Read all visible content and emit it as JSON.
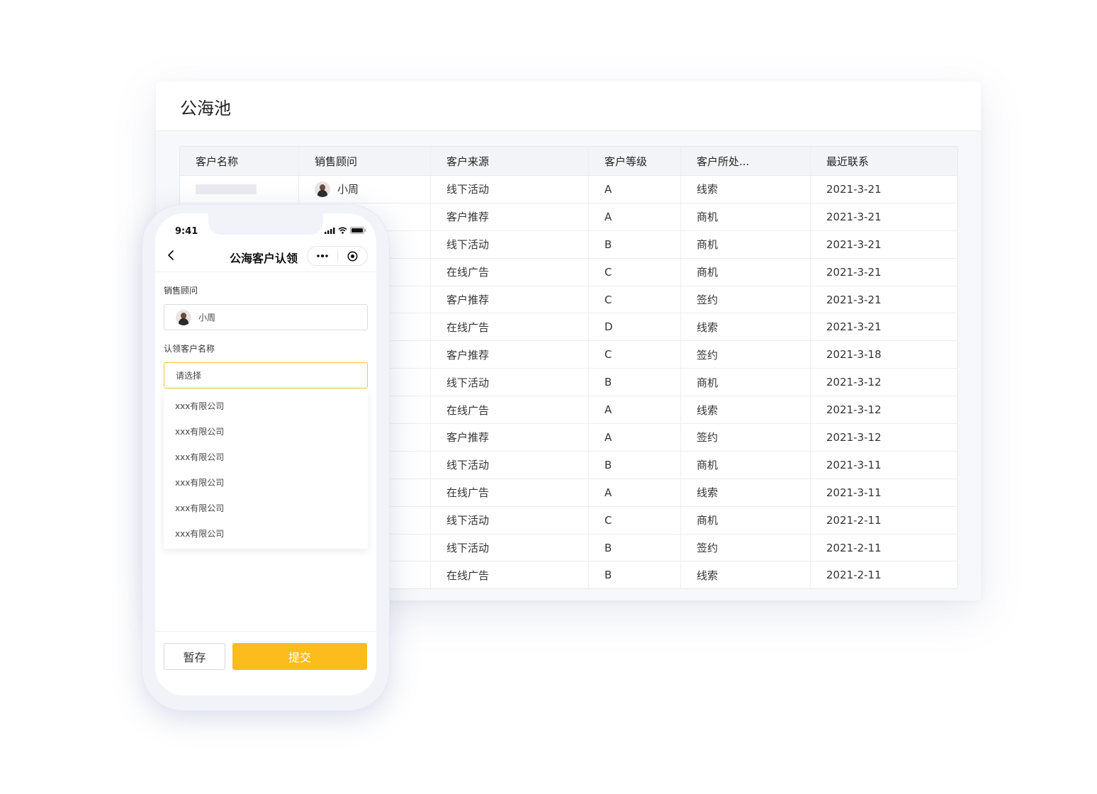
{
  "desktop": {
    "title": "公海池",
    "columns": [
      "客户名称",
      "销售顾问",
      "客户来源",
      "客户等级",
      "客户所处...",
      "最近联系"
    ],
    "first_row_advisor": "小周",
    "rows": [
      {
        "source": "线下活动",
        "level": "A",
        "stage": "线索",
        "date": "2021-3-21"
      },
      {
        "source": "客户推荐",
        "level": "A",
        "stage": "商机",
        "date": "2021-3-21"
      },
      {
        "source": "线下活动",
        "level": "B",
        "stage": "商机",
        "date": "2021-3-21"
      },
      {
        "source": "在线广告",
        "level": "C",
        "stage": "商机",
        "date": "2021-3-21"
      },
      {
        "source": "客户推荐",
        "level": "C",
        "stage": "签约",
        "date": "2021-3-21"
      },
      {
        "source": "在线广告",
        "level": "D",
        "stage": "线索",
        "date": "2021-3-21"
      },
      {
        "source": "客户推荐",
        "level": "C",
        "stage": "签约",
        "date": "2021-3-18"
      },
      {
        "source": "线下活动",
        "level": "B",
        "stage": "商机",
        "date": "2021-3-12"
      },
      {
        "source": "在线广告",
        "level": "A",
        "stage": "线索",
        "date": "2021-3-12"
      },
      {
        "source": "客户推荐",
        "level": "A",
        "stage": "签约",
        "date": "2021-3-12"
      },
      {
        "source": "线下活动",
        "level": "B",
        "stage": "商机",
        "date": "2021-3-11"
      },
      {
        "source": "在线广告",
        "level": "A",
        "stage": "线索",
        "date": "2021-3-11"
      },
      {
        "source": "线下活动",
        "level": "C",
        "stage": "商机",
        "date": "2021-2-11"
      },
      {
        "source": "线下活动",
        "level": "B",
        "stage": "签约",
        "date": "2021-2-11"
      },
      {
        "source": "在线广告",
        "level": "B",
        "stage": "线索",
        "date": "2021-2-11"
      }
    ]
  },
  "phone": {
    "time": "9:41",
    "title": "公海客户认领",
    "advisor_label": "销售顾问",
    "advisor_value": "小周",
    "customer_label": "认领客户名称",
    "customer_placeholder": "请选择",
    "options": [
      "xxx有限公司",
      "xxx有限公司",
      "xxx有限公司",
      "xxx有限公司",
      "xxx有限公司",
      "xxx有限公司"
    ],
    "save_label": "暂存",
    "submit_label": "提交"
  },
  "colors": {
    "accent": "#fdbc1d",
    "focus_border": "#f6c343"
  },
  "icons": [
    "avatar-icon",
    "back-icon",
    "more-icon",
    "record-icon",
    "signal-icon",
    "wifi-icon",
    "battery-icon"
  ]
}
